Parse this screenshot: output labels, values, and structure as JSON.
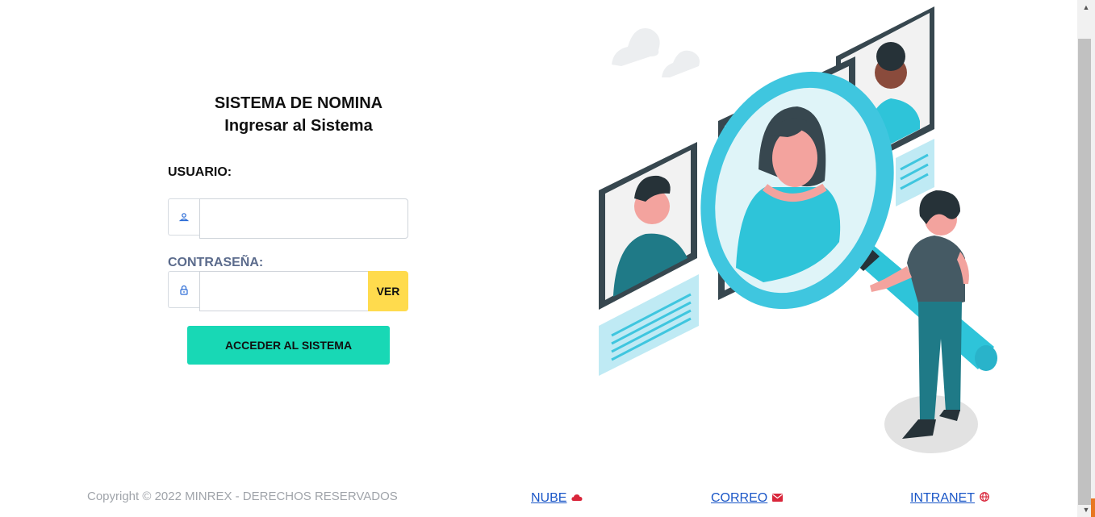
{
  "login": {
    "title": "SISTEMA DE NOMINA",
    "subtitle": "Ingresar al Sistema",
    "user_label": "USUARIO:",
    "user_value": "",
    "password_label": "CONTRASEÑA:",
    "password_value": "",
    "show_button": "VER",
    "submit_button": "ACCEDER AL SISTEMA"
  },
  "footer": {
    "copyright": "Copyright © 2022 MINREX - DERECHOS RESERVADOS",
    "links": [
      {
        "label": "NUBE",
        "icon": "cloud-icon"
      },
      {
        "label": "CORREO",
        "icon": "envelope-icon"
      },
      {
        "label": "INTRANET",
        "icon": "globe-icon"
      }
    ]
  },
  "colors": {
    "accent": "#18d8b5",
    "show_button": "#ffdb4d",
    "link": "#1a56c7",
    "footer_icons": "#d9263b",
    "illustration_cyan": "#3fc6df"
  }
}
